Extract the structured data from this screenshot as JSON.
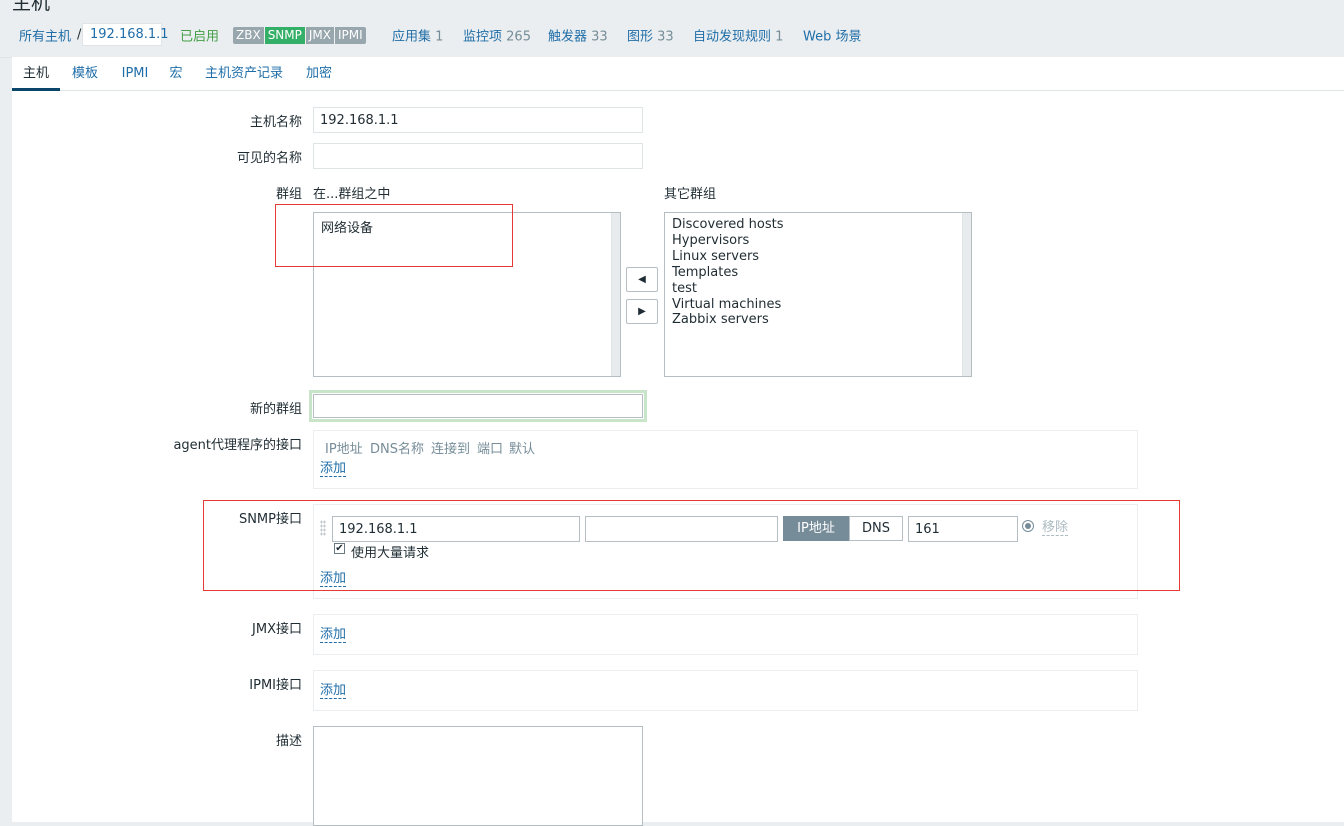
{
  "page": {
    "title": "主机"
  },
  "breadcrumb": {
    "all_hosts": "所有主机",
    "separator": "/",
    "current_host": "192.168.1.1"
  },
  "status": {
    "enabled": "已启用"
  },
  "badges": [
    "ZBX",
    "SNMP",
    "JMX",
    "IPMI"
  ],
  "header_links": [
    {
      "label": "应用集",
      "count": "1"
    },
    {
      "label": "监控项",
      "count": "265"
    },
    {
      "label": "触发器",
      "count": "33"
    },
    {
      "label": "图形",
      "count": "33"
    },
    {
      "label": "自动发现规则",
      "count": "1"
    },
    {
      "label": "Web 场景",
      "count": ""
    }
  ],
  "tabs": [
    "主机",
    "模板",
    "IPMI",
    "宏",
    "主机资产记录",
    "加密"
  ],
  "form": {
    "host_name_label": "主机名称",
    "host_name_value": "192.168.1.1",
    "visible_name_label": "可见的名称",
    "visible_name_value": "",
    "groups_label": "群组",
    "in_groups_label": "在...群组之中",
    "other_groups_label": "其它群组",
    "in_groups": [
      "网络设备"
    ],
    "other_groups": [
      "Discovered hosts",
      "Hypervisors",
      "Linux servers",
      "Templates",
      "test",
      "Virtual machines",
      "Zabbix servers"
    ],
    "new_group_label": "新的群组",
    "new_group_value": "",
    "agent_interfaces_label": "agent代理程序的接口",
    "interface_headers": [
      "IP地址",
      "DNS名称",
      "连接到",
      "端口",
      "默认"
    ],
    "add_link": "添加",
    "snmp_label": "SNMP接口",
    "snmp": {
      "ip": "192.168.1.1",
      "dns": "",
      "connect_ip": "IP地址",
      "connect_dns": "DNS",
      "port": "161",
      "remove": "移除",
      "bulk_label": "使用大量请求",
      "bulk_checked": true
    },
    "jmx_label": "JMX接口",
    "ipmi_label": "IPMI接口",
    "description_label": "描述"
  },
  "colors": {
    "link": "#1f6ea8",
    "enabled": "#429e47",
    "snmp_badge": "#34af67",
    "highlight_box": "#e53935"
  },
  "icons": {
    "move_left": "triangle-left",
    "move_right": "triangle-right"
  }
}
